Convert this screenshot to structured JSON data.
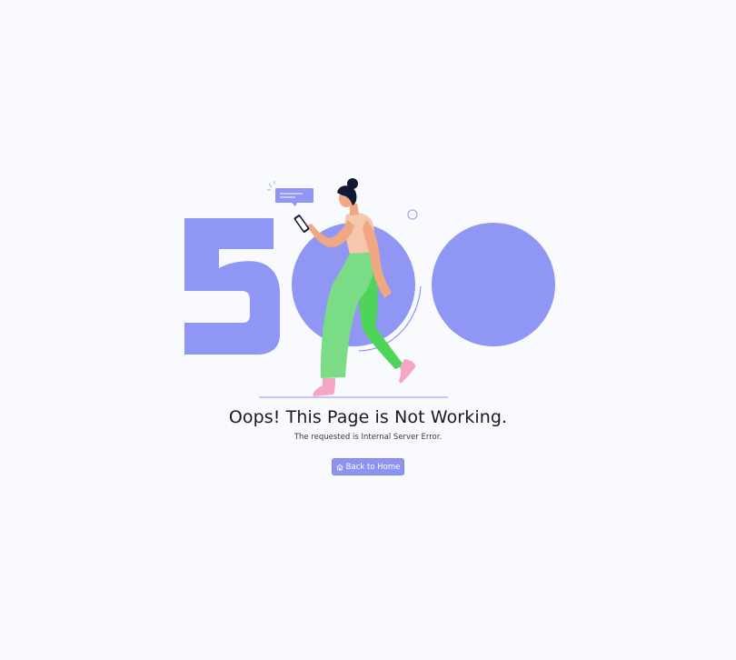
{
  "error": {
    "code_digits": [
      "5",
      "0",
      "0"
    ],
    "title": "Oops! This Page is Not Working.",
    "message": "The requested is Internal Server Error."
  },
  "actions": {
    "home_label": "Back to Home",
    "home_icon": "home-icon"
  },
  "colors": {
    "accent": "#8f96f3",
    "background": "#f9fafd",
    "pants": "#7bdc86",
    "skin": "#f0a882",
    "shoes": "#f3a6c6",
    "hair": "#111831"
  }
}
